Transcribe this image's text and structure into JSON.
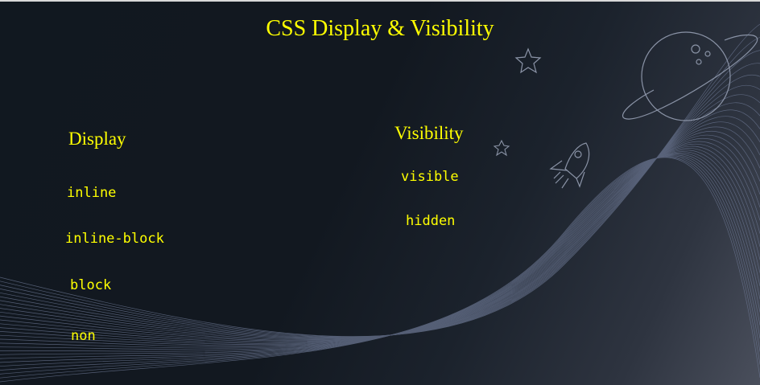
{
  "page": {
    "title": "CSS Display & Visibility",
    "text_color": "#ffff00",
    "background_color": "#111820"
  },
  "display": {
    "heading": "Display",
    "options": [
      "inline",
      "inline-block",
      "block",
      "non"
    ]
  },
  "visibility": {
    "heading": "Visibility",
    "options": [
      "visible",
      "hidden"
    ]
  },
  "decorations": {
    "icons": [
      "planet-icon",
      "star-icon",
      "star-icon",
      "rocket-icon"
    ],
    "background": "line-wave-pattern"
  }
}
